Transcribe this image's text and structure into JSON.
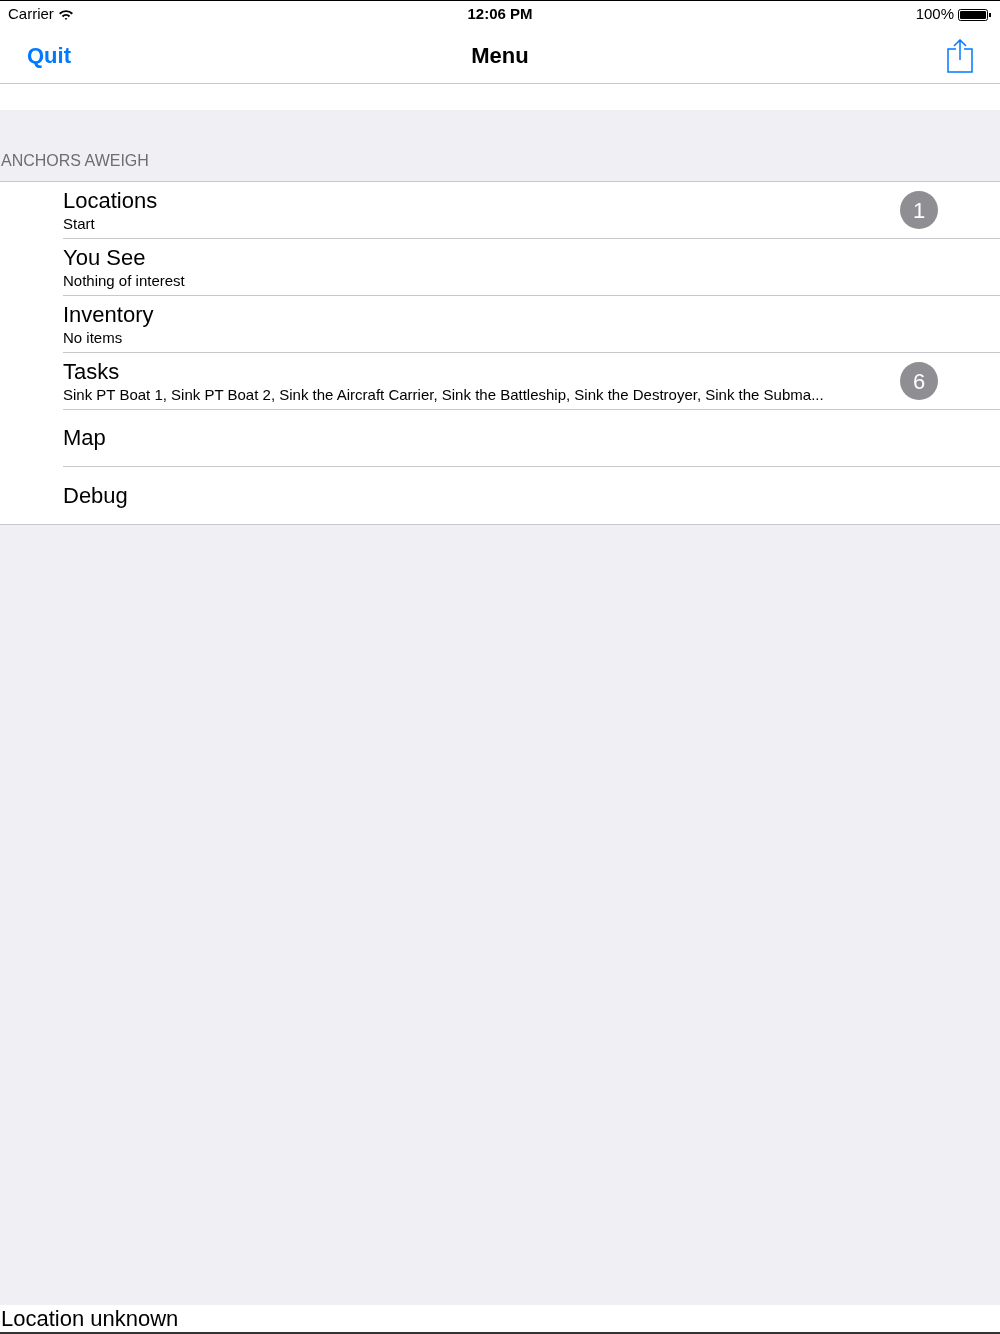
{
  "status_bar": {
    "carrier": "Carrier",
    "time": "12:06 PM",
    "battery": "100%"
  },
  "nav_bar": {
    "left_button": "Quit",
    "title": "Menu"
  },
  "section": {
    "header": "ANCHORS AWEIGH",
    "rows": [
      {
        "title": "Locations",
        "subtitle": "Start",
        "badge": "1"
      },
      {
        "title": "You See",
        "subtitle": "Nothing of interest"
      },
      {
        "title": "Inventory",
        "subtitle": "No items"
      },
      {
        "title": "Tasks",
        "subtitle": "Sink PT Boat 1, Sink PT Boat 2, Sink the Aircraft Carrier, Sink the Battleship, Sink the Destroyer, Sink the Subma...",
        "badge": "6"
      },
      {
        "title": "Map"
      },
      {
        "title": "Debug"
      }
    ]
  },
  "footer": {
    "text": "Location unknown"
  }
}
